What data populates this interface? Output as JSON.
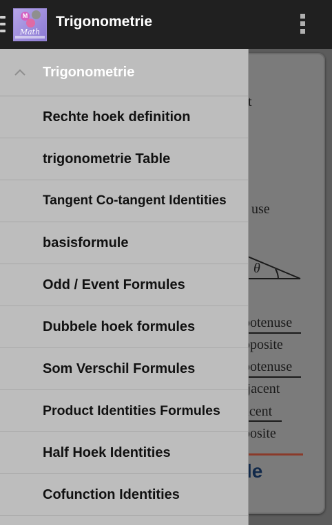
{
  "appbar": {
    "title": "Trigonometrie",
    "logo_text": "Math",
    "logo_letter": "M",
    "overflow_icon": "more-vert-icon"
  },
  "drawer": {
    "header": {
      "label": "Trigonometrie",
      "icon": "chevron-up-icon"
    },
    "items": [
      {
        "label": "Rechte hoek definition"
      },
      {
        "label": "trigonometrie Table"
      },
      {
        "label": "Tangent Co-tangent Identities"
      },
      {
        "label": "basisformule"
      },
      {
        "label": "Odd / Event Formules"
      },
      {
        "label": "Dubbele hoek formules"
      },
      {
        "label": "Som Verschil Formules"
      },
      {
        "label": "Product Identities Formules"
      },
      {
        "label": "Half Hoek Identities"
      },
      {
        "label": "Cofunction Identities"
      }
    ]
  },
  "background": {
    "frag_1": "t",
    "frag_2": "use",
    "theta": "θ",
    "frag_3": "potenuse",
    "frag_4": "pposite",
    "frag_5": "potenuse",
    "frag_6": "ljacent",
    "frag_7": "acent",
    "frag_8": "posite",
    "frag_9": "le"
  }
}
